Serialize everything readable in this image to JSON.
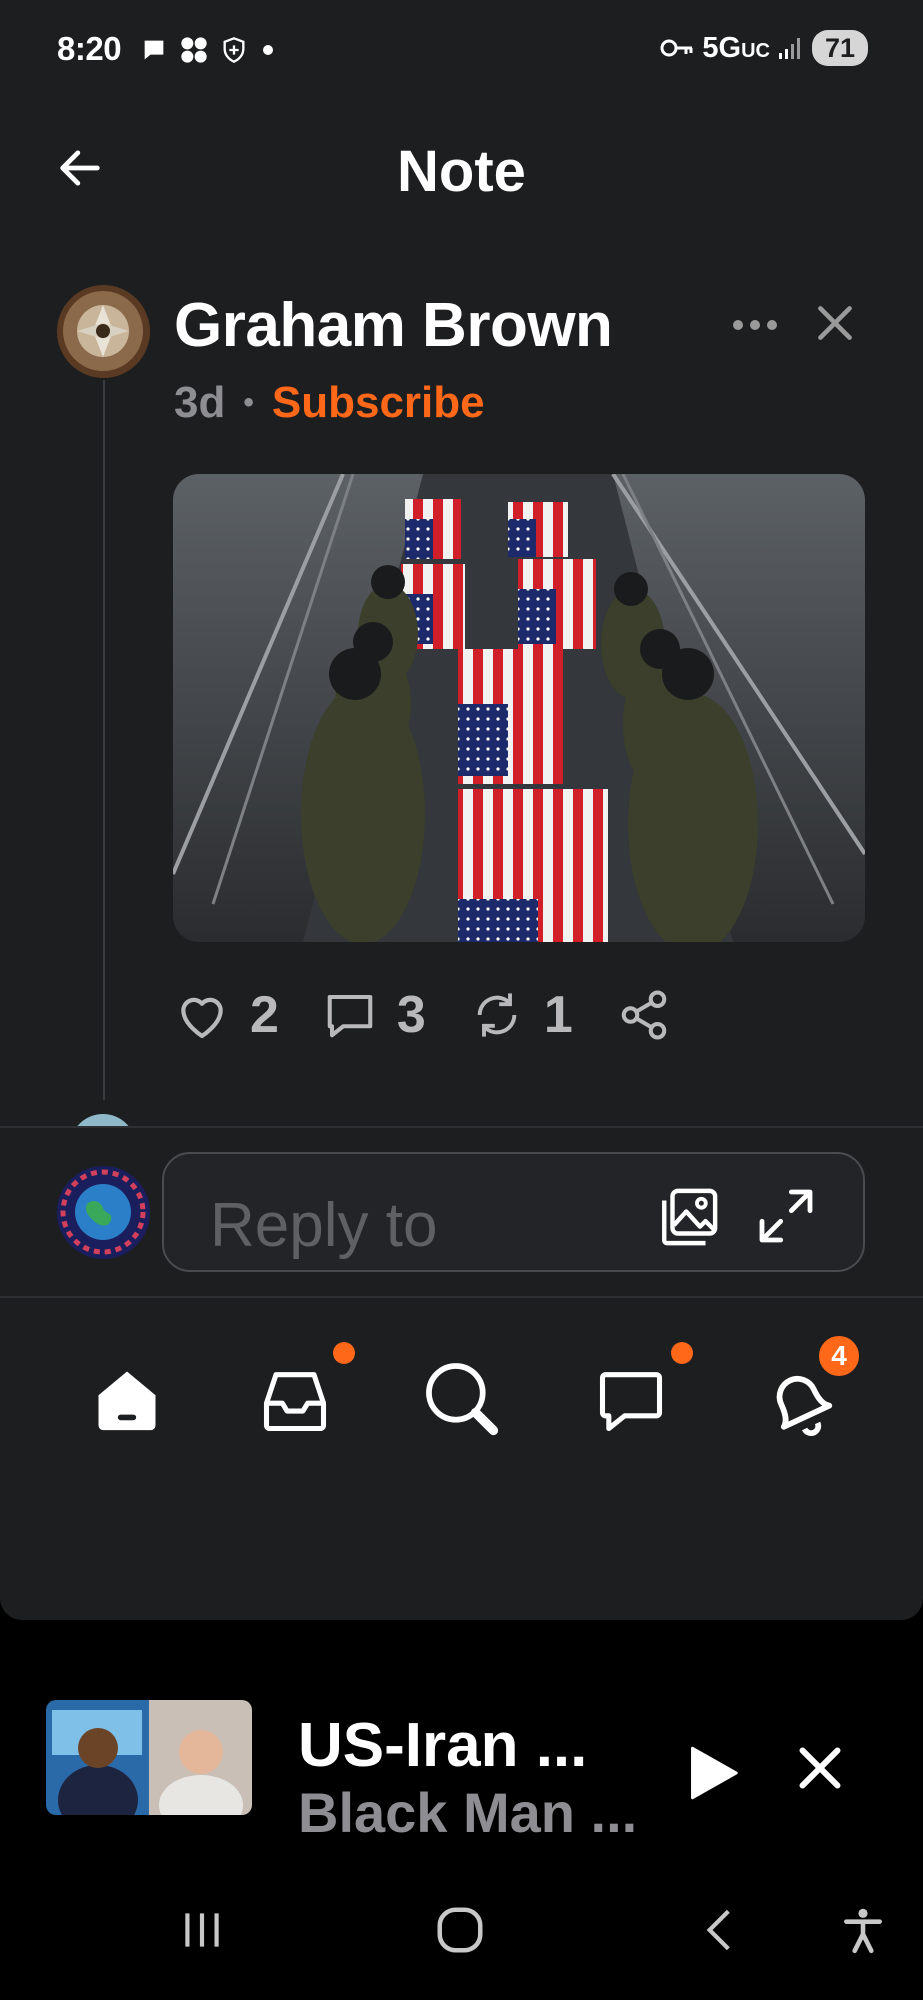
{
  "status_bar": {
    "time": "8:20",
    "network": "5G",
    "network_suffix": "UC",
    "battery": "71"
  },
  "header": {
    "title": "Note"
  },
  "post": {
    "author": "Graham Brown",
    "age": "3d",
    "separator": "•",
    "subscribe_label": "Subscribe",
    "image_icon": "flag-draped-caskets-photo",
    "likes": "2",
    "comments": "3",
    "restacks": "1"
  },
  "reply": {
    "placeholder": "Reply to"
  },
  "nav": {
    "items": [
      "home",
      "inbox",
      "search",
      "chat",
      "activity"
    ],
    "activity_badge": "4"
  },
  "player": {
    "title": "US-Iran ...",
    "subtitle": "Black Man ..."
  },
  "colors": {
    "background": "#1d1e20",
    "accent": "#ff6719",
    "muted": "#8e8e92"
  }
}
